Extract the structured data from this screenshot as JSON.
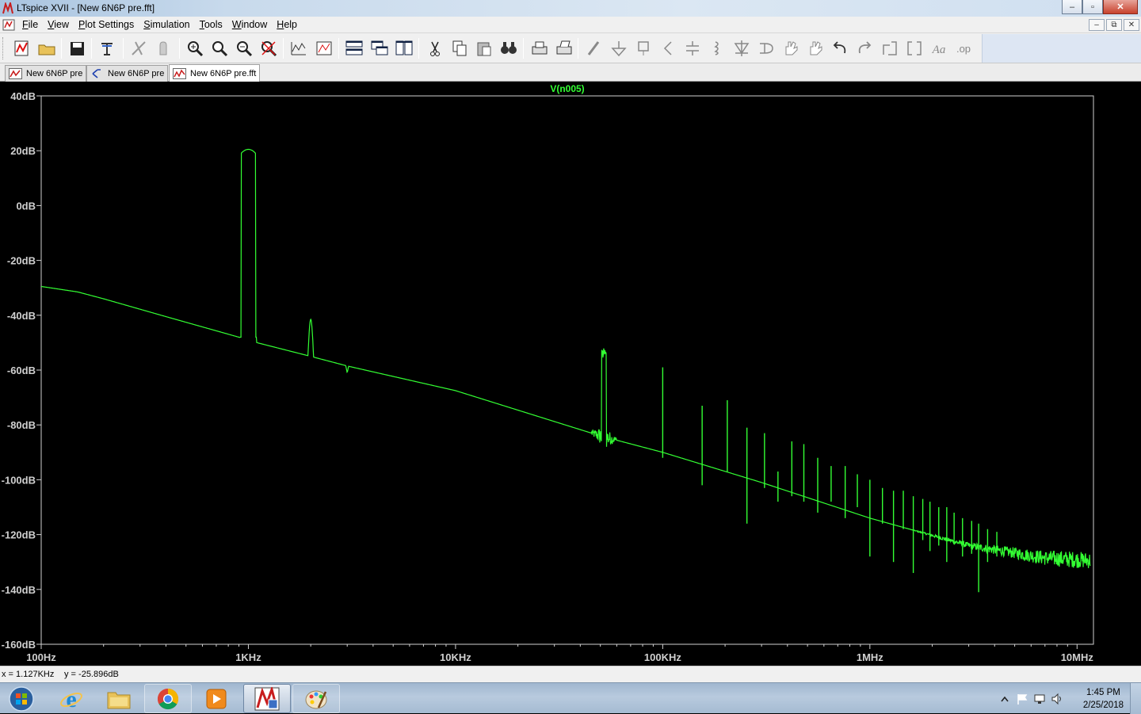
{
  "window": {
    "title": "LTspice XVII - [New 6N6P pre.fft]",
    "minimize": "–",
    "maximize": "▫",
    "close": "✕"
  },
  "menu": {
    "items": [
      "File",
      "View",
      "Plot Settings",
      "Simulation",
      "Tools",
      "Window",
      "Help"
    ]
  },
  "toolbar": {
    "buttons": [
      "new-schematic",
      "open",
      "save",
      "control-panel",
      "run",
      "halt",
      "zoom-area",
      "zoom-back",
      "zoom-out",
      "zoom-fit",
      "autorange",
      "mark",
      "tile-horizontal",
      "cascade",
      "tile-vertical",
      "cut",
      "copy",
      "paste",
      "find",
      "print",
      "print-setup",
      "draw-wire",
      "ground",
      "label-net",
      "resistor",
      "capacitor",
      "inductor",
      "diode",
      "component",
      "move",
      "drag",
      "undo",
      "redo",
      "rotate",
      "mirror",
      "text",
      "spice-directive"
    ]
  },
  "tabs": [
    {
      "label": "New 6N6P pre",
      "icon": "schematic-icon"
    },
    {
      "label": "New 6N6P pre",
      "icon": "symbol-icon"
    },
    {
      "label": "New 6N6P pre.fft",
      "icon": "waveform-icon",
      "active": true
    }
  ],
  "plot": {
    "trace_label": "V(n005)",
    "trace_color": "#33ff33",
    "background": "#000000",
    "axis_color": "#d0d0d0"
  },
  "chart_data": {
    "type": "line",
    "title": "V(n005)",
    "xscale": "log",
    "xlim": [
      100,
      12000000
    ],
    "ylim": [
      -160,
      40
    ],
    "x_ticks": [
      "100Hz",
      "1KHz",
      "10KHz",
      "100KHz",
      "1MHz",
      "10MHz"
    ],
    "y_ticks": [
      "40dB",
      "20dB",
      "0dB",
      "-20dB",
      "-40dB",
      "-60dB",
      "-80dB",
      "-100dB",
      "-120dB",
      "-140dB",
      "-160dB"
    ],
    "series": [
      {
        "name": "V(n005)",
        "baseline": [
          [
            100,
            -29.5
          ],
          [
            150,
            -31.5
          ],
          [
            200,
            -34
          ],
          [
            400,
            -40.5
          ],
          [
            900,
            -48
          ],
          [
            1100,
            -50
          ],
          [
            2000,
            -55
          ],
          [
            3000,
            -58.5
          ],
          [
            10000,
            -67.5
          ],
          [
            50000,
            -84
          ],
          [
            100000,
            -90
          ],
          [
            300000,
            -101
          ],
          [
            1000000,
            -114
          ],
          [
            3000000,
            -124
          ],
          [
            7000000,
            -128.5
          ],
          [
            12000000,
            -129.5
          ]
        ],
        "peaks": [
          {
            "x": 1000,
            "y": 20.5
          },
          {
            "x": 2000,
            "y": -41.5
          },
          {
            "x": 3000,
            "y": -61
          },
          {
            "x": 52000,
            "y": -54
          },
          {
            "x": 100000,
            "y": -59
          },
          {
            "x": 155000,
            "y": -73
          },
          {
            "x": 205000,
            "y": -71
          },
          {
            "x": 255000,
            "y": -81
          }
        ]
      }
    ]
  },
  "status": {
    "x": "x = 1.127KHz",
    "y": "y = -25.896dB"
  },
  "taskbar": {
    "apps": [
      "start-orb",
      "internet-explorer",
      "file-explorer",
      "chrome",
      "media-player",
      "ltspice",
      "paint"
    ],
    "time": "1:45 PM",
    "date": "2/25/2018"
  }
}
